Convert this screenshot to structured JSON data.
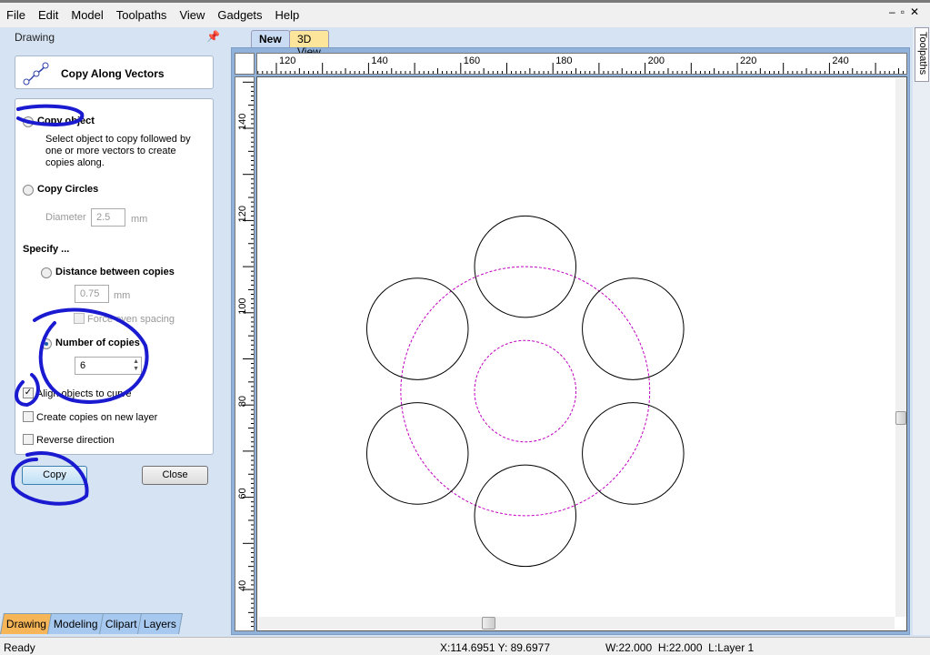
{
  "menu": [
    "File",
    "Edit",
    "Model",
    "Toolpaths",
    "View",
    "Gadgets",
    "Help"
  ],
  "panel": {
    "title": "Drawing",
    "tool_title": "Copy Along Vectors"
  },
  "form": {
    "copy_object": "Copy object",
    "copy_object_desc": [
      "Select object to copy followed by",
      "one or more vectors to create",
      "copies along."
    ],
    "copy_circles": "Copy Circles",
    "diameter_label": "Diameter",
    "diameter_value": "2.5",
    "unit": "mm",
    "specify": "Specify ...",
    "distance": "Distance between copies",
    "distance_value": "0.75",
    "force_even": "Force even spacing",
    "number_of_copies": "Number of copies",
    "copies_value": "6",
    "align": "Align objects to curve",
    "align_checked": true,
    "new_layer": "Create copies on new layer",
    "reverse": "Reverse direction",
    "selected_mode": "Number of copies"
  },
  "buttons": {
    "copy": "Copy",
    "close": "Close"
  },
  "bottom_tabs": [
    "Drawing",
    "Modeling",
    "Clipart",
    "Layers"
  ],
  "view_tabs": [
    "New",
    "3D View"
  ],
  "right_tab": "Toolpaths",
  "rulers": {
    "x_labels": [
      "120",
      "140",
      "160",
      "180",
      "200",
      "220",
      "240"
    ],
    "y_labels": [
      "140",
      "120",
      "100",
      "80",
      "60",
      "40"
    ]
  },
  "drawing": {
    "center": [
      174,
      83
    ],
    "path_circle_diameter": 54,
    "inner_circle_diameter": 22,
    "copy_diameter": 22,
    "copies": 6,
    "copy_color": "#000000",
    "vector_color": "#c000c0"
  },
  "annotation_color": "#1a1ad0",
  "status": {
    "ready": "Ready",
    "coords": "X:114.6951 Y: 89.6977",
    "size": "W:22.000  H:22.000  L:Layer 1"
  }
}
